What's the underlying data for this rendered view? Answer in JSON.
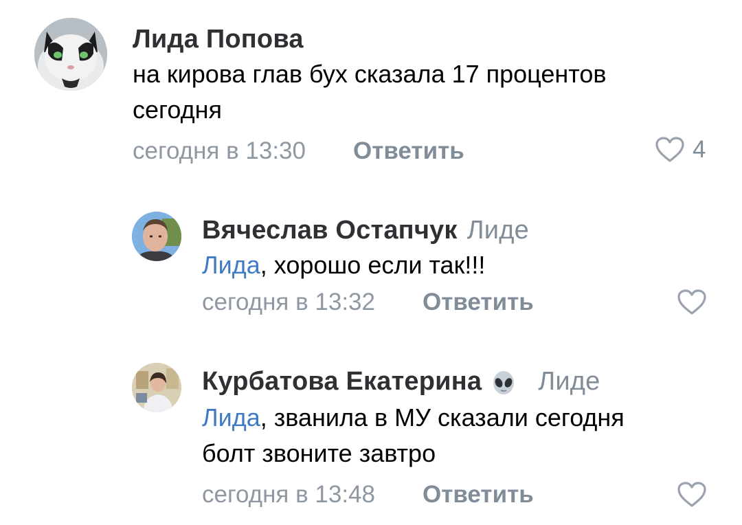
{
  "comments": [
    {
      "author": "Лида Попова",
      "reply_to": "",
      "mention": "",
      "text_lines": [
        "на кирова глав бух сказала 17 процентов",
        "сегодня"
      ],
      "time": "сегодня в 13:30",
      "reply_label": "Ответить",
      "likes": "4",
      "avatar_icon": "cat-avatar"
    },
    {
      "author": "Вячеслав Остапчук",
      "reply_to": "Лиде",
      "mention": "Лида",
      "text_lines": [
        ", хорошо если так!!!"
      ],
      "time": "сегодня в 13:32",
      "reply_label": "Ответить",
      "likes": "",
      "avatar_icon": "man-avatar"
    },
    {
      "author": "Курбатова Екатерина",
      "reply_to": "Лиде",
      "mention": "Лида",
      "text_lines": [
        ", званила в МУ сказали сегодня",
        "болт звоните завтро"
      ],
      "time": "сегодня в 13:48",
      "reply_label": "Ответить",
      "likes": "",
      "avatar_icon": "woman-avatar"
    }
  ],
  "colors": {
    "name": "#2f3034",
    "meta": "#8e97a2",
    "mention": "#3f7ac4"
  }
}
